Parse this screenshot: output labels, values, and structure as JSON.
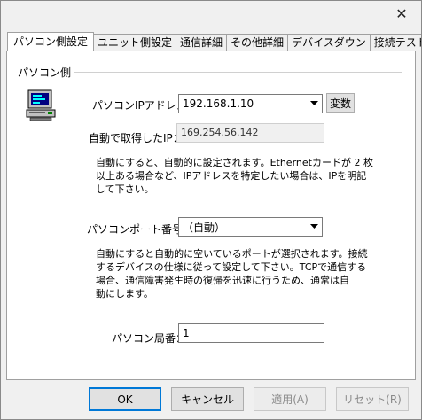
{
  "window": {
    "close_glyph": "✕"
  },
  "tabs": [
    {
      "label": "パソコン側設定",
      "active": true
    },
    {
      "label": "ユニット側設定"
    },
    {
      "label": "通信詳細"
    },
    {
      "label": "その他詳細"
    },
    {
      "label": "デバイスダウン"
    },
    {
      "label": "接続テスト"
    }
  ],
  "group": {
    "title": "パソコン側",
    "icon": "computer-icon"
  },
  "ip": {
    "label": "パソコンIPアドレス：",
    "value": "192.168.1.10",
    "variable_button": "変数"
  },
  "auto_ip": {
    "label": "自動で取得したIP：",
    "value": "169.254.56.142"
  },
  "ip_desc": [
    "自動にすると、自動的に設定されます。Ethernetカードが 2 枚",
    "以上ある場合など、IPアドレスを特定したい場合は、IPを明記",
    "して下さい。"
  ],
  "port": {
    "label": "パソコンポート番号：",
    "value": "（自動）"
  },
  "port_desc": [
    "自動にすると自動的に空いているポートが選択されます。接続",
    "するデバイスの仕様に従って設定して下さい。TCPで通信する",
    "場合、通信障害発生時の復帰を迅速に行うため、通常は自",
    "動にします。"
  ],
  "station": {
    "label": "パソコン局番：",
    "value": "1"
  },
  "buttons": {
    "ok": "OK",
    "cancel": "キャンセル",
    "apply": "適用(A)",
    "reset": "リセット(R)"
  }
}
